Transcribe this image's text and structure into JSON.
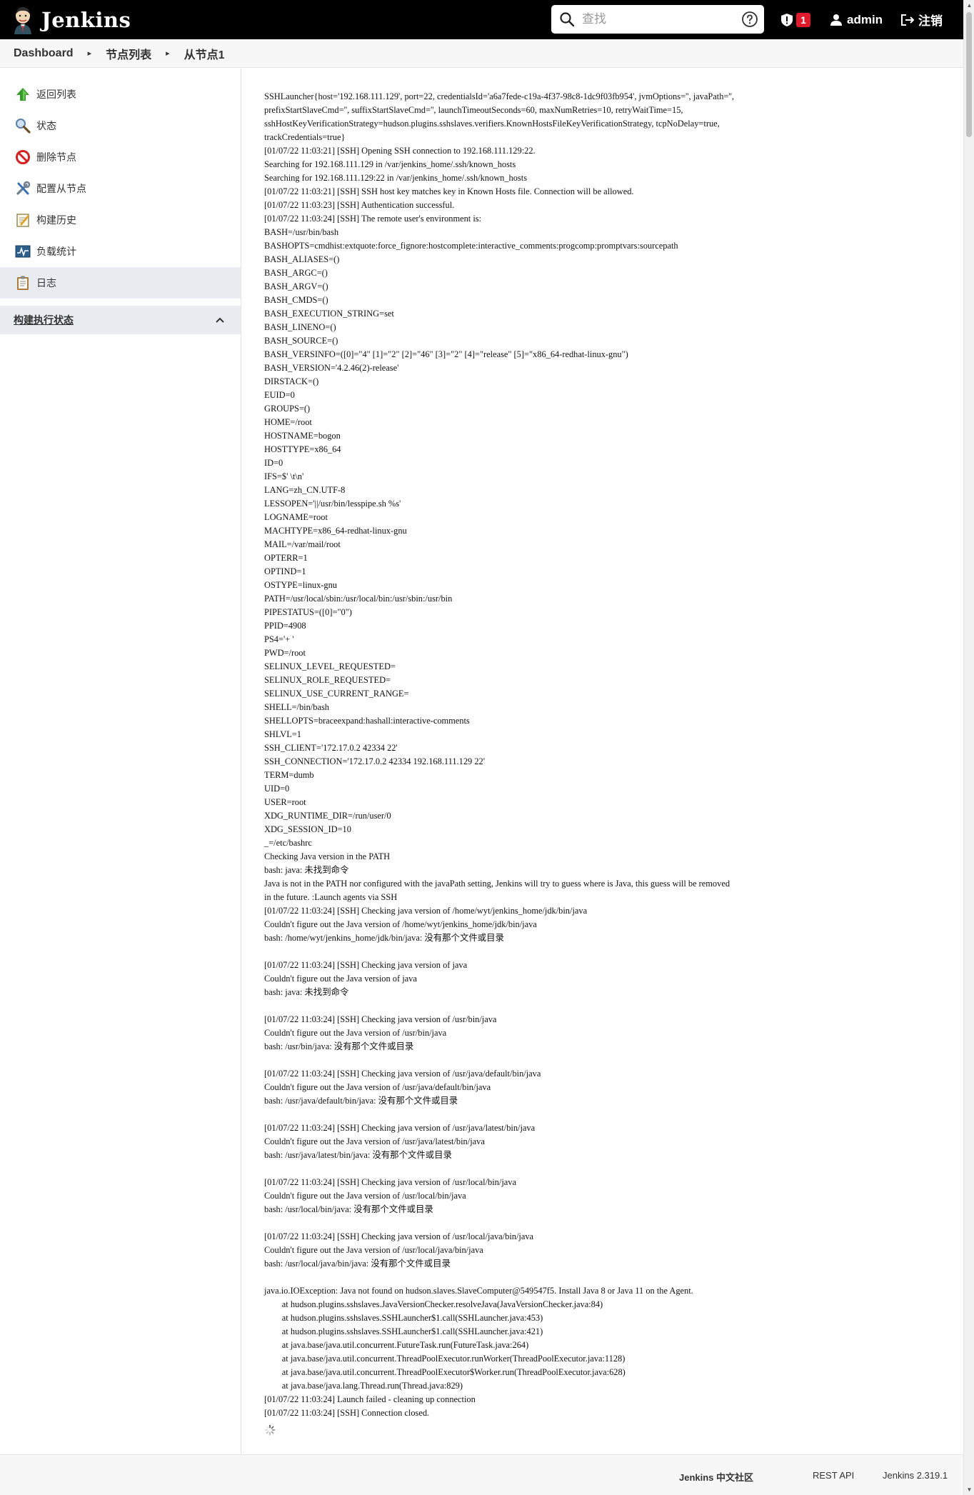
{
  "header": {
    "app_title": "Jenkins",
    "search_placeholder": "查找",
    "security_badge_count": "1",
    "user": "admin",
    "logout_label": "注销"
  },
  "breadcrumb": [
    "Dashboard",
    "节点列表",
    "从节点1"
  ],
  "sidebar": {
    "items": [
      {
        "label": "返回列表",
        "icon": "up-arrow-icon"
      },
      {
        "label": "状态",
        "icon": "magnifier-icon"
      },
      {
        "label": "删除节点",
        "icon": "no-entry-icon"
      },
      {
        "label": "配置从节点",
        "icon": "tools-icon"
      },
      {
        "label": "构建历史",
        "icon": "notepad-icon"
      },
      {
        "label": "负载统计",
        "icon": "load-chart-icon"
      },
      {
        "label": "日志",
        "icon": "clipboard-icon",
        "active": true
      }
    ],
    "executor_pane_title": "构建执行状态"
  },
  "console_lines": [
    "SSHLauncher{host='192.168.111.129', port=22, credentialsId='a6a7fede-c19a-4f37-98c8-1dc9f03fb954', jvmOptions='', javaPath='',",
    "prefixStartSlaveCmd='', suffixStartSlaveCmd='', launchTimeoutSeconds=60, maxNumRetries=10, retryWaitTime=15,",
    "sshHostKeyVerificationStrategy=hudson.plugins.sshslaves.verifiers.KnownHostsFileKeyVerificationStrategy, tcpNoDelay=true,",
    "trackCredentials=true}",
    "[01/07/22 11:03:21] [SSH] Opening SSH connection to 192.168.111.129:22.",
    "Searching for 192.168.111.129 in /var/jenkins_home/.ssh/known_hosts",
    "Searching for 192.168.111.129:22 in /var/jenkins_home/.ssh/known_hosts",
    "[01/07/22 11:03:21] [SSH] SSH host key matches key in Known Hosts file. Connection will be allowed.",
    "[01/07/22 11:03:23] [SSH] Authentication successful.",
    "[01/07/22 11:03:24] [SSH] The remote user's environment is:",
    "BASH=/usr/bin/bash",
    "BASHOPTS=cmdhist:extquote:force_fignore:hostcomplete:interactive_comments:progcomp:promptvars:sourcepath",
    "BASH_ALIASES=()",
    "BASH_ARGC=()",
    "BASH_ARGV=()",
    "BASH_CMDS=()",
    "BASH_EXECUTION_STRING=set",
    "BASH_LINENO=()",
    "BASH_SOURCE=()",
    "BASH_VERSINFO=([0]=\"4\" [1]=\"2\" [2]=\"46\" [3]=\"2\" [4]=\"release\" [5]=\"x86_64-redhat-linux-gnu\")",
    "BASH_VERSION='4.2.46(2)-release'",
    "DIRSTACK=()",
    "EUID=0",
    "GROUPS=()",
    "HOME=/root",
    "HOSTNAME=bogon",
    "HOSTTYPE=x86_64",
    "ID=0",
    "IFS=$' \\t\\n'",
    "LANG=zh_CN.UTF-8",
    "LESSOPEN='||/usr/bin/lesspipe.sh %s'",
    "LOGNAME=root",
    "MACHTYPE=x86_64-redhat-linux-gnu",
    "MAIL=/var/mail/root",
    "OPTERR=1",
    "OPTIND=1",
    "OSTYPE=linux-gnu",
    "PATH=/usr/local/sbin:/usr/local/bin:/usr/sbin:/usr/bin",
    "PIPESTATUS=([0]=\"0\")",
    "PPID=4908",
    "PS4='+ '",
    "PWD=/root",
    "SELINUX_LEVEL_REQUESTED=",
    "SELINUX_ROLE_REQUESTED=",
    "SELINUX_USE_CURRENT_RANGE=",
    "SHELL=/bin/bash",
    "SHELLOPTS=braceexpand:hashall:interactive-comments",
    "SHLVL=1",
    "SSH_CLIENT='172.17.0.2 42334 22'",
    "SSH_CONNECTION='172.17.0.2 42334 192.168.111.129 22'",
    "TERM=dumb",
    "UID=0",
    "USER=root",
    "XDG_RUNTIME_DIR=/run/user/0",
    "XDG_SESSION_ID=10",
    "_=/etc/bashrc",
    "Checking Java version in the PATH",
    "bash: java: 未找到命令",
    "Java is not in the PATH nor configured with the javaPath setting, Jenkins will try to guess where is Java, this guess will be removed",
    "in the future. :Launch agents via SSH",
    "[01/07/22 11:03:24] [SSH] Checking java version of /home/wyt/jenkins_home/jdk/bin/java",
    "Couldn't figure out the Java version of /home/wyt/jenkins_home/jdk/bin/java",
    "bash: /home/wyt/jenkins_home/jdk/bin/java: 没有那个文件或目录",
    "",
    "[01/07/22 11:03:24] [SSH] Checking java version of java",
    "Couldn't figure out the Java version of java",
    "bash: java: 未找到命令",
    "",
    "[01/07/22 11:03:24] [SSH] Checking java version of /usr/bin/java",
    "Couldn't figure out the Java version of /usr/bin/java",
    "bash: /usr/bin/java: 没有那个文件或目录",
    "",
    "[01/07/22 11:03:24] [SSH] Checking java version of /usr/java/default/bin/java",
    "Couldn't figure out the Java version of /usr/java/default/bin/java",
    "bash: /usr/java/default/bin/java: 没有那个文件或目录",
    "",
    "[01/07/22 11:03:24] [SSH] Checking java version of /usr/java/latest/bin/java",
    "Couldn't figure out the Java version of /usr/java/latest/bin/java",
    "bash: /usr/java/latest/bin/java: 没有那个文件或目录",
    "",
    "[01/07/22 11:03:24] [SSH] Checking java version of /usr/local/bin/java",
    "Couldn't figure out the Java version of /usr/local/bin/java",
    "bash: /usr/local/bin/java: 没有那个文件或目录",
    "",
    "[01/07/22 11:03:24] [SSH] Checking java version of /usr/local/java/bin/java",
    "Couldn't figure out the Java version of /usr/local/java/bin/java",
    "bash: /usr/local/java/bin/java: 没有那个文件或目录",
    "",
    "java.io.IOException: Java not found on hudson.slaves.SlaveComputer@549547f5. Install Java 8 or Java 11 on the Agent.",
    "\tat hudson.plugins.sshslaves.JavaVersionChecker.resolveJava(JavaVersionChecker.java:84)",
    "\tat hudson.plugins.sshslaves.SSHLauncher$1.call(SSHLauncher.java:453)",
    "\tat hudson.plugins.sshslaves.SSHLauncher$1.call(SSHLauncher.java:421)",
    "\tat java.base/java.util.concurrent.FutureTask.run(FutureTask.java:264)",
    "\tat java.base/java.util.concurrent.ThreadPoolExecutor.runWorker(ThreadPoolExecutor.java:1128)",
    "\tat java.base/java.util.concurrent.ThreadPoolExecutor$Worker.run(ThreadPoolExecutor.java:628)",
    "\tat java.base/java.lang.Thread.run(Thread.java:829)",
    "[01/07/22 11:03:24] Launch failed - cleaning up connection",
    "[01/07/22 11:03:24] [SSH] Connection closed."
  ],
  "footer": {
    "community": "Jenkins 中文社区",
    "rest_api": "REST API",
    "version": "Jenkins 2.319.1"
  },
  "colors": {
    "header_bg": "#000000",
    "badge_red": "#e0192c",
    "sidebar_active_bg": "#e9edf2"
  }
}
